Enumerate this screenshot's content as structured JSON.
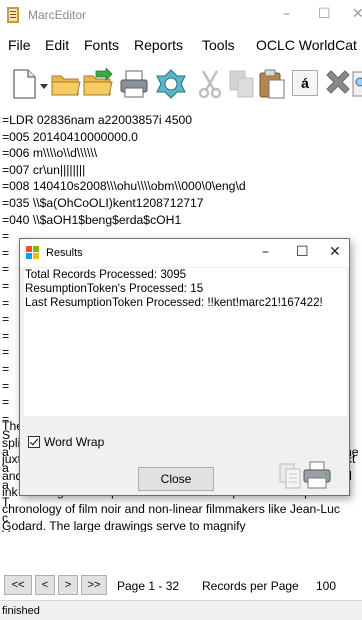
{
  "app": {
    "title": "MarcEditor"
  },
  "window_controls": {
    "minimize": "–",
    "maximize": "☐",
    "close": "✕"
  },
  "menu": [
    "File",
    "Edit",
    "Fonts",
    "Reports",
    "Tools",
    "OCLC WorldCat"
  ],
  "toolbar": {
    "icons": [
      "new-file-icon",
      "open-folder-icon",
      "open-folder-green-icon",
      "print-icon",
      "valid-icon",
      "cut-icon",
      "copy-icon",
      "paste-icon",
      "special-char-icon",
      "delete-icon",
      "find-icon"
    ],
    "special_char_label": "á"
  },
  "record": {
    "lines": [
      "=LDR  02836nam a22003857i 4500",
      "=005  20140410000000.0",
      "=006  m\\\\\\\\o\\\\d\\\\\\\\\\\\",
      "=007  cr\\un||||||||",
      "=008  140410s2008\\\\\\ohu\\\\\\\\obm\\\\000\\0\\eng\\d",
      "=035  \\\\$a(OhCoOLI)kent1208712717",
      "=040  \\\\$aOH1$beng$erda$cOH1"
    ],
    "partial_prefixes": [
      "=",
      "=",
      "=",
      "=",
      "=",
      "=",
      "=",
      "=",
      "=",
      "=",
      "=",
      "=",
      "S",
      "a",
      "a",
      "a",
      "T",
      "c",
      "V",
      "m",
      "re",
      "in",
      "e",
      "Th"
    ],
    "partial_suffixes": {
      "he": "he",
      "s": "s"
    },
    "paragraph": "These drawings are sequenced into loosely formed non-linear splintered chronologies. The free form method utilizes the juxtaposition of camera shots, subject matter, psychological effect and value. The images are rendered at various scales. The small ink drawings are sequenced in order to emphasize the splintered chronology of film noir and non-linear filmmakers like Jean-Luc Godard. The large drawings serve to magnify"
  },
  "pager": {
    "first": "<<",
    "prev": "<",
    "next": ">",
    "last": ">>",
    "page_label": "Page 1 - 32",
    "records_per_page_label": "Records per Page",
    "records_per_page_value": "100"
  },
  "status": {
    "text": "finished"
  },
  "dialog": {
    "title": "Results",
    "lines": [
      "Total Records Processed: 3095",
      "ResumptionToken's Processed: 15",
      "Last ResumptionToken Processed: !!kent!marc21!167422!"
    ],
    "word_wrap_label": "Word Wrap",
    "word_wrap_checked": true,
    "close_label": "Close"
  }
}
